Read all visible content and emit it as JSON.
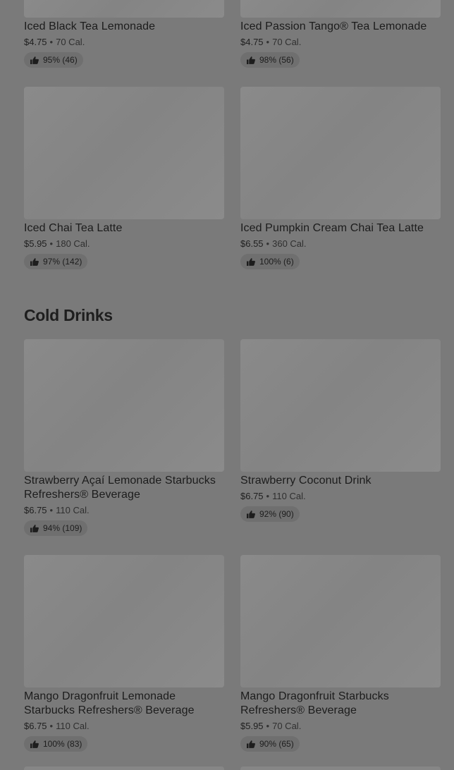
{
  "top_row": [
    {
      "name": "Iced Black Tea Lemonade",
      "price": "$4.75",
      "calories": "70 Cal.",
      "rating": "95% (46)"
    },
    {
      "name": "Iced Passion Tango® Tea Lemonade",
      "price": "$4.75",
      "calories": "70 Cal.",
      "rating": "98% (56)"
    }
  ],
  "tea_row_2": [
    {
      "name": "Iced Chai Tea Latte",
      "price": "$5.95",
      "calories": "180 Cal.",
      "rating": "97% (142)"
    },
    {
      "name": "Iced Pumpkin Cream Chai Tea Latte",
      "price": "$6.55",
      "calories": "360 Cal.",
      "rating": "100% (6)"
    }
  ],
  "cold_drinks": {
    "title": "Cold Drinks",
    "row_1": [
      {
        "name": "Strawberry Açaí Lemonade Starbucks Refreshers® Beverage",
        "price": "$6.75",
        "calories": "110 Cal.",
        "rating": "94% (109)"
      },
      {
        "name": "Strawberry Coconut Drink",
        "price": "$6.75",
        "calories": "110 Cal.",
        "rating": "92% (90)"
      }
    ],
    "row_2": [
      {
        "name": "Mango Dragonfruit Lemonade Starbucks Refreshers® Beverage",
        "price": "$6.75",
        "calories": "110 Cal.",
        "rating": "100% (83)"
      },
      {
        "name": "Mango Dragonfruit Starbucks Refreshers® Beverage",
        "price": "$5.95",
        "calories": "70 Cal.",
        "rating": "90% (65)"
      }
    ]
  },
  "separator": "•",
  "icons": {
    "rating": "thumbs-up-icon"
  },
  "colors": {
    "overlay_background": "#7a7a7a",
    "placeholder_image": "#888888"
  }
}
